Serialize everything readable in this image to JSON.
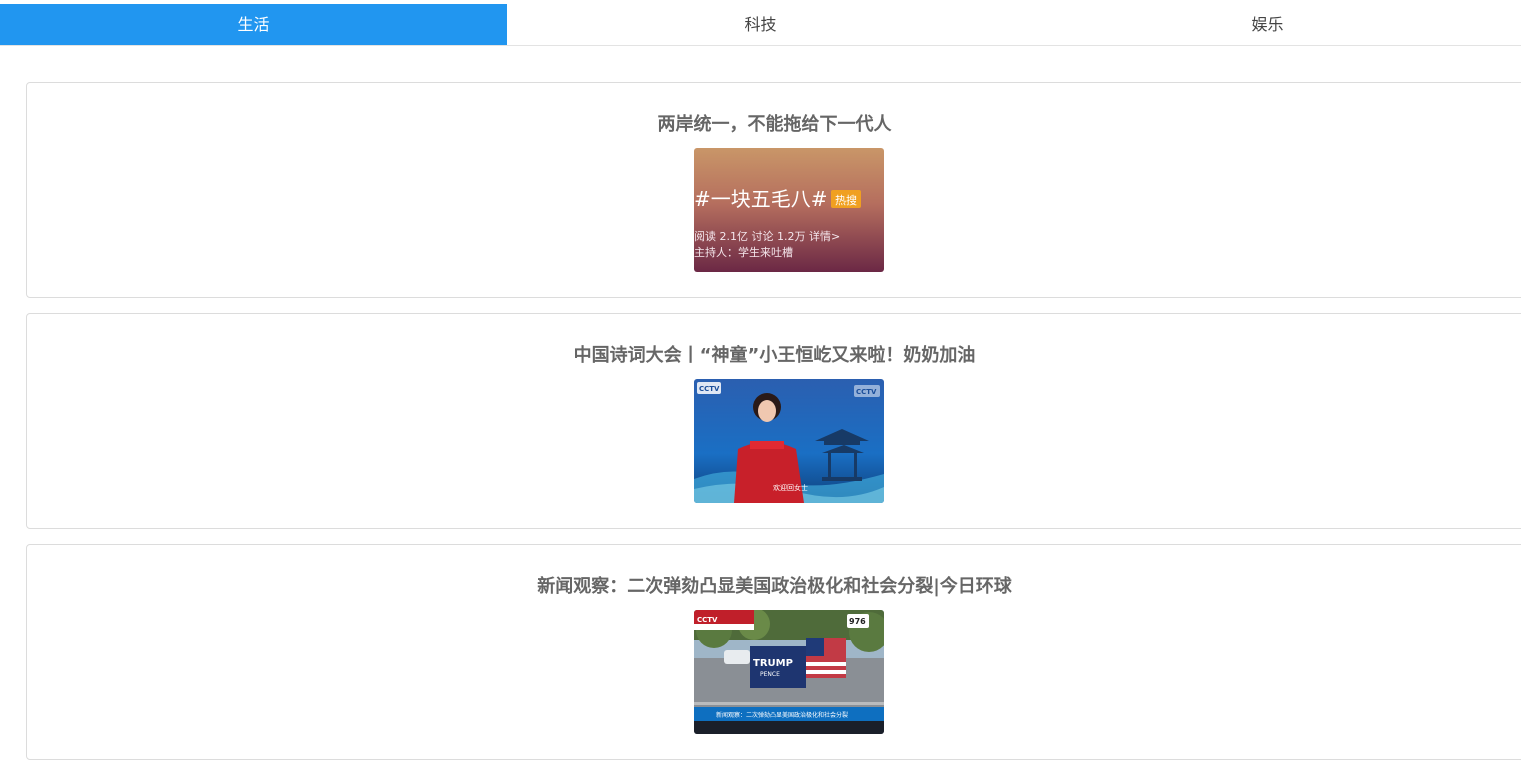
{
  "tabs": [
    {
      "label": "生活",
      "active": true
    },
    {
      "label": "科技",
      "active": false
    },
    {
      "label": "娱乐",
      "active": false
    }
  ],
  "colors": {
    "active_tab": "#2196f0",
    "title_text": "#666666",
    "card_border": "#dcdcdc"
  },
  "articles": [
    {
      "title": "两岸统一，不能拖给下一代人",
      "thumbnail": {
        "topic": "#一块五毛八#",
        "badge": "热搜",
        "stats": "阅读 2.1亿  讨论 1.2万  详情>",
        "host": "主持人：学生来吐槽"
      }
    },
    {
      "title": "中国诗词大会丨“神童”小王恒屹又来啦！奶奶加油",
      "thumbnail": {
        "channel_logo": "CCTV",
        "caption": "欢迎回女士"
      }
    },
    {
      "title": "新闻观察：二次弹劾凸显美国政治极化和社会分裂|今日环球",
      "thumbnail": {
        "channel_logo": "CCTV",
        "sign_line1": "TRUMP",
        "sign_line2": "PENCE",
        "road_sign": "976",
        "ticker": "新闻观察：二次弹劾凸显美国政治极化和社会分裂"
      }
    }
  ]
}
